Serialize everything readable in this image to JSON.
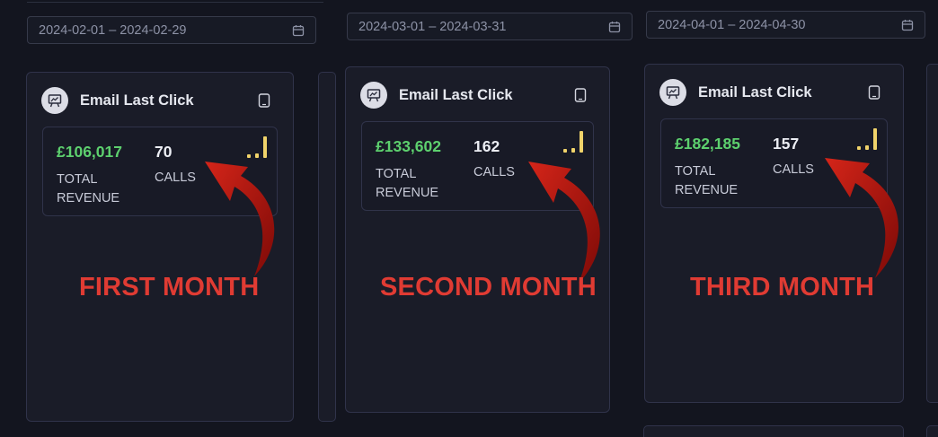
{
  "date_ranges": [
    {
      "text": "2024-02-01 – 2024-02-29"
    },
    {
      "text": "2024-03-01 – 2024-03-31"
    },
    {
      "text": "2024-04-01 – 2024-04-30"
    }
  ],
  "cards": [
    {
      "title": "Email Last Click",
      "revenue": "£106,017",
      "calls": "70",
      "revenue_label": "TOTAL REVENUE",
      "calls_label": "CALLS",
      "annotation": "FIRST MONTH"
    },
    {
      "title": "Email Last Click",
      "revenue": "£133,602",
      "calls": "162",
      "revenue_label": "TOTAL REVENUE",
      "calls_label": "CALLS",
      "annotation": "SECOND MONTH"
    },
    {
      "title": "Email Last Click",
      "revenue": "£182,185",
      "calls": "157",
      "revenue_label": "TOTAL REVENUE",
      "calls_label": "CALLS",
      "annotation": "THIRD MONTH"
    }
  ],
  "colors": {
    "background": "#13151f",
    "revenue": "#5dd06e",
    "signal": "#f0d36a",
    "annotation": "#e03b33",
    "arrow": "#a8100c"
  },
  "icons": {
    "avatar": "presentation-chart-icon",
    "calendar": "calendar-icon",
    "document": "tablet-icon",
    "signal": "signal-bars-icon"
  }
}
